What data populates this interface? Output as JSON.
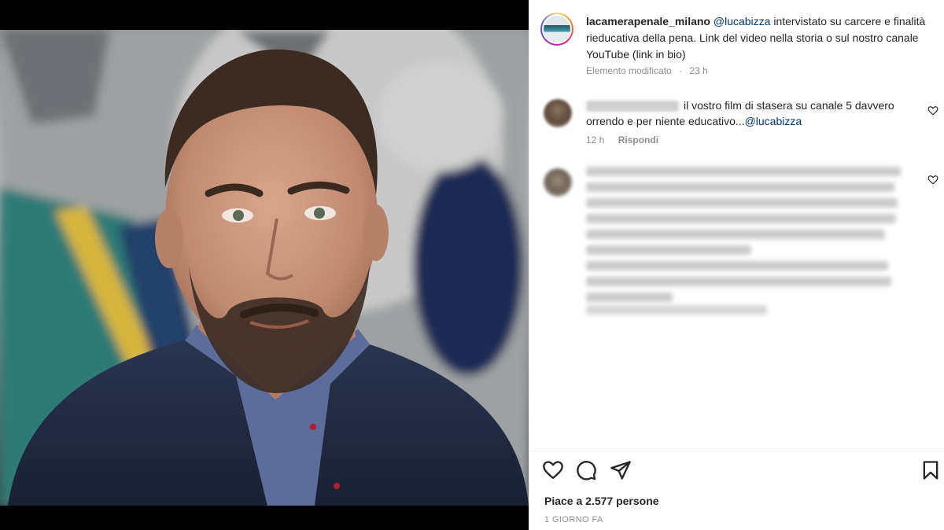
{
  "post": {
    "caption": {
      "username": "lacamerapenale_milano",
      "mention": "@lucabizza",
      "text": " intervistato su carcere e finalità rieducativa della pena. Link del video nella storia o sul nostro canale YouTube (link in bio)"
    },
    "caption_meta": {
      "edited": "Elemento modificato",
      "separator": "·",
      "time": "23 h"
    },
    "comments": [
      {
        "text": "il vostro film di stasera su canale 5 davvero orrendo e per niente educativo...",
        "mention": "@lucabizza",
        "time": "12 h",
        "reply_label": "Rispondi"
      }
    ],
    "likes": "Piace a 2.577 persone",
    "timestamp": "1 GIORNO FA"
  },
  "icons": {
    "like": "heart-icon",
    "comment": "comment-bubble-icon",
    "share": "paper-plane-icon",
    "save": "bookmark-icon",
    "comment_like": "heart-icon"
  },
  "colors": {
    "text": "#262626",
    "muted": "#8e8e8e",
    "link": "#00376b",
    "background": "#ffffff"
  }
}
